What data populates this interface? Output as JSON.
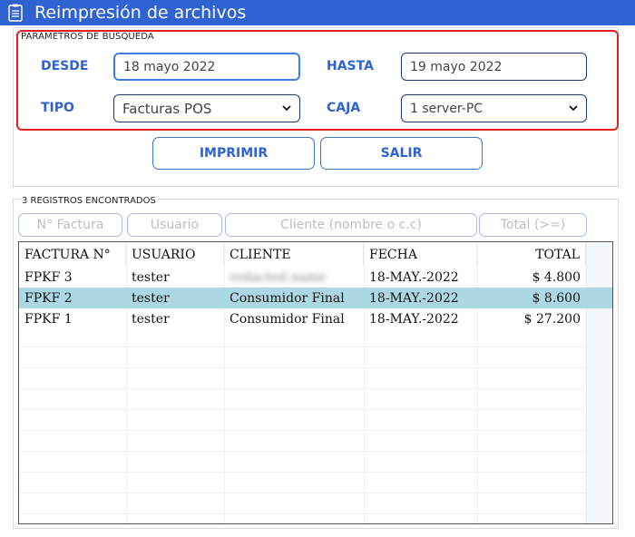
{
  "window": {
    "title": "Reimpresión de archivos",
    "title_bar_color": "#2f63d1"
  },
  "params": {
    "caption": "PARÁMETROS DE BÚSQUEDA",
    "desde_label": "DESDE",
    "desde_value": "18 mayo 2022",
    "hasta_label": "HASTA",
    "hasta_value": "19 mayo 2022",
    "tipo_label": "TIPO",
    "tipo_value": "Facturas POS",
    "caja_label": "CAJA",
    "caja_value": "1 server-PC",
    "highlight_color": "#e02020"
  },
  "actions": {
    "print_label": "IMPRIMIR",
    "exit_label": "SALIR"
  },
  "results": {
    "caption": "3 REGISTROS ENCONTRADOS",
    "filters": {
      "invoice_placeholder": "N° Factura",
      "user_placeholder": "Usuario",
      "client_placeholder": "Cliente (nombre o c.c)",
      "total_placeholder": "Total (>=)"
    },
    "columns": [
      "FACTURA N°",
      "USUARIO",
      "CLIENTE",
      "FECHA",
      "TOTAL"
    ],
    "rows": [
      {
        "factura": "FPKF 3",
        "usuario": "tester",
        "cliente": "redacted name",
        "fecha": "18-MAY.-2022",
        "total": "$ 4.800",
        "selected": false
      },
      {
        "factura": "FPKF 2",
        "usuario": "tester",
        "cliente": "Consumidor Final",
        "fecha": "18-MAY.-2022",
        "total": "$ 8.600",
        "selected": true
      },
      {
        "factura": "FPKF 1",
        "usuario": "tester",
        "cliente": "Consumidor Final",
        "fecha": "18-MAY.-2022",
        "total": "$ 27.200",
        "selected": false
      }
    ],
    "selected_row_color": "#acd8e4"
  },
  "icons": {
    "title_icon": "document-list-icon",
    "dropdown_icon": "chevron-down-icon"
  }
}
